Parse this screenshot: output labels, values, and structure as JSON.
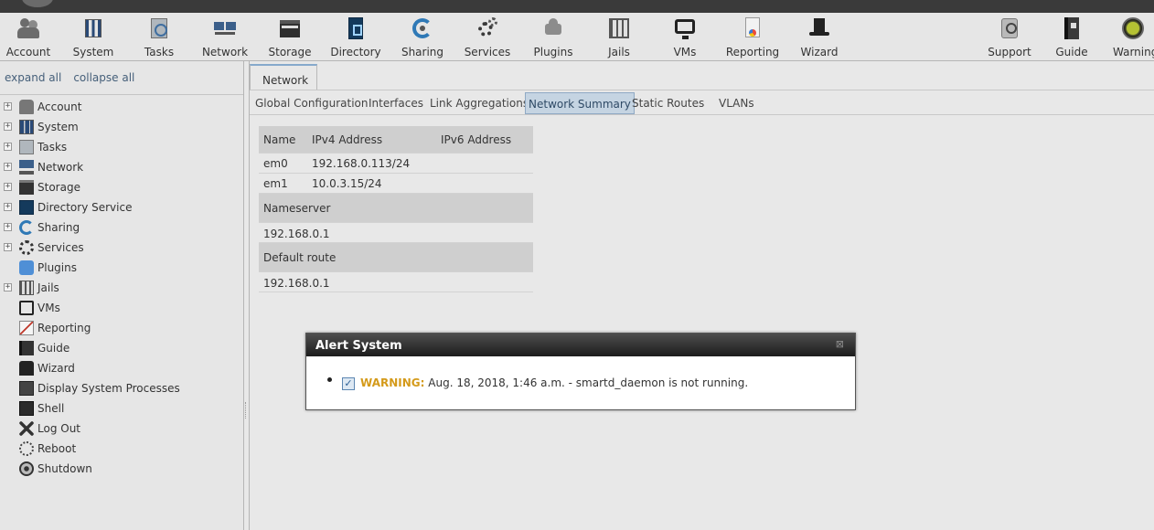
{
  "toolbar": {
    "left_items": [
      {
        "label": "Account",
        "icon": "account-icon"
      },
      {
        "label": "System",
        "icon": "system-icon"
      },
      {
        "label": "Tasks",
        "icon": "tasks-icon"
      },
      {
        "label": "Network",
        "icon": "network-icon"
      },
      {
        "label": "Storage",
        "icon": "storage-icon"
      },
      {
        "label": "Directory",
        "icon": "directory-icon"
      },
      {
        "label": "Sharing",
        "icon": "sharing-icon"
      },
      {
        "label": "Services",
        "icon": "services-icon"
      },
      {
        "label": "Plugins",
        "icon": "plugins-icon"
      },
      {
        "label": "Jails",
        "icon": "jails-icon"
      },
      {
        "label": "VMs",
        "icon": "vms-icon"
      },
      {
        "label": "Reporting",
        "icon": "reporting-icon"
      },
      {
        "label": "Wizard",
        "icon": "wizard-icon"
      }
    ],
    "right_items": [
      {
        "label": "Support",
        "icon": "support-icon"
      },
      {
        "label": "Guide",
        "icon": "guide-icon"
      },
      {
        "label": "Warning",
        "icon": "warning-light-icon"
      }
    ]
  },
  "sidebar": {
    "expand_all": "expand all",
    "collapse_all": "collapse all",
    "items": [
      {
        "label": "Account",
        "expandable": true
      },
      {
        "label": "System",
        "expandable": true
      },
      {
        "label": "Tasks",
        "expandable": true
      },
      {
        "label": "Network",
        "expandable": true
      },
      {
        "label": "Storage",
        "expandable": true
      },
      {
        "label": "Directory Service",
        "expandable": true
      },
      {
        "label": "Sharing",
        "expandable": true
      },
      {
        "label": "Services",
        "expandable": true
      },
      {
        "label": "Plugins",
        "expandable": false
      },
      {
        "label": "Jails",
        "expandable": true
      },
      {
        "label": "VMs",
        "expandable": false
      },
      {
        "label": "Reporting",
        "expandable": false
      },
      {
        "label": "Guide",
        "expandable": false
      },
      {
        "label": "Wizard",
        "expandable": false
      },
      {
        "label": "Display System Processes",
        "expandable": false
      },
      {
        "label": "Shell",
        "expandable": false
      },
      {
        "label": "Log Out",
        "expandable": false
      },
      {
        "label": "Reboot",
        "expandable": false
      },
      {
        "label": "Shutdown",
        "expandable": false
      }
    ]
  },
  "main": {
    "tab": "Network",
    "subtabs": [
      {
        "label": "Global Configuration",
        "active": false
      },
      {
        "label": "Interfaces",
        "active": false
      },
      {
        "label": "Link Aggregations",
        "active": false
      },
      {
        "label": "Network Summary",
        "active": true
      },
      {
        "label": "Static Routes",
        "active": false
      },
      {
        "label": "VLANs",
        "active": false
      }
    ],
    "summary": {
      "headers": {
        "name": "Name",
        "ipv4": "IPv4 Address",
        "ipv6": "IPv6 Address"
      },
      "interfaces": [
        {
          "name": "em0",
          "ipv4": "192.168.0.113/24",
          "ipv6": ""
        },
        {
          "name": "em1",
          "ipv4": "10.0.3.15/24",
          "ipv6": ""
        }
      ],
      "nameserver_label": "Nameserver",
      "nameserver": "192.168.0.1",
      "default_route_label": "Default route",
      "default_route": "192.168.0.1"
    }
  },
  "alert": {
    "title": "Alert System",
    "close_glyph": "⊠",
    "check_glyph": "✓",
    "level": "WARNING:",
    "message": "Aug. 18, 2018, 1:46 a.m. - smartd_daemon is not running.",
    "level_color": "#d49a1a"
  }
}
